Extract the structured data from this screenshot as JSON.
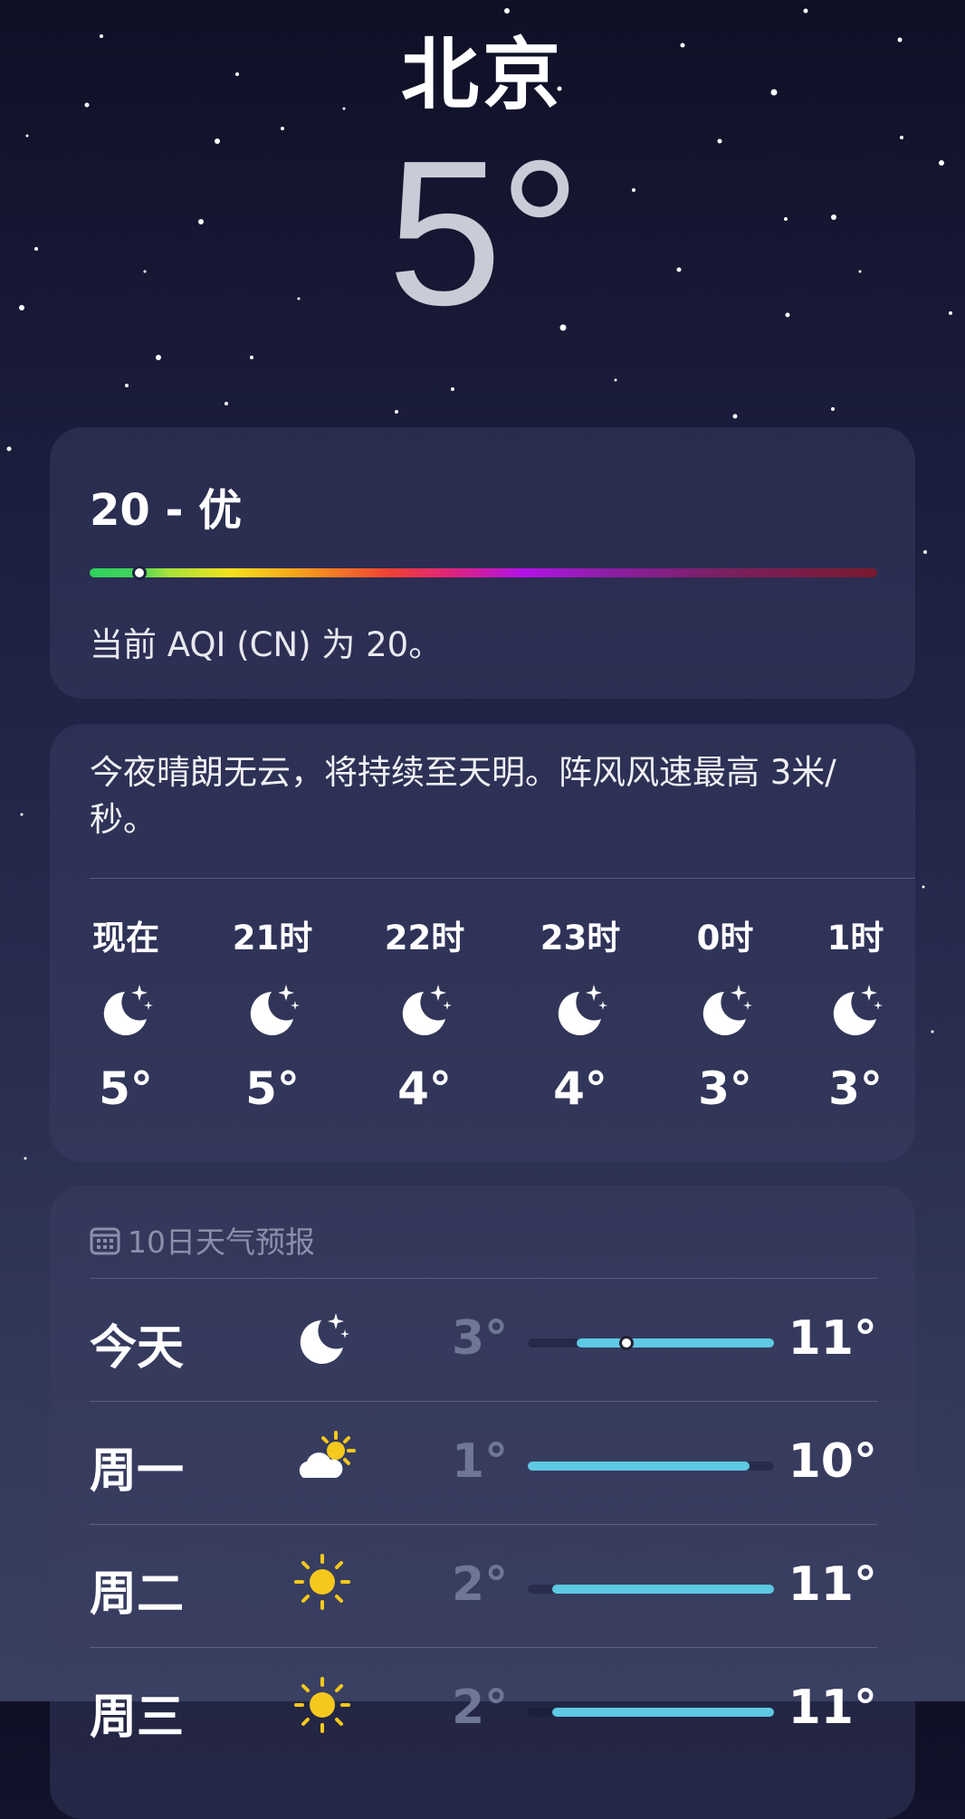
{
  "location": {
    "city": "北京",
    "temperature": "5°"
  },
  "aqi": {
    "title": "20 - 优",
    "value": 20,
    "scale_max": 500,
    "description": "当前 AQI (CN) 为 20。"
  },
  "hourly": {
    "summary": "今夜晴朗无云，将持续至天明。阵风风速最高 3米/秒。",
    "items": [
      {
        "time": "现在",
        "icon": "moon-stars-icon",
        "temp": "5°"
      },
      {
        "time": "21时",
        "icon": "moon-stars-icon",
        "temp": "5°"
      },
      {
        "time": "22时",
        "icon": "moon-stars-icon",
        "temp": "4°"
      },
      {
        "time": "23时",
        "icon": "moon-stars-icon",
        "temp": "4°"
      },
      {
        "time": "0时",
        "icon": "moon-stars-icon",
        "temp": "3°"
      },
      {
        "time": "1时",
        "icon": "moon-stars-icon",
        "temp": "3°"
      }
    ]
  },
  "forecast": {
    "title": "10日天气预报",
    "range_min": 1,
    "range_max": 11,
    "days": [
      {
        "day": "今天",
        "icon": "moon-stars-icon",
        "low": "3°",
        "high": "11°",
        "low_value": 3,
        "high_value": 11,
        "current_value": 5
      },
      {
        "day": "周一",
        "icon": "partly-cloudy-sun-icon",
        "low": "1°",
        "high": "10°",
        "low_value": 1,
        "high_value": 10
      },
      {
        "day": "周二",
        "icon": "sun-icon",
        "low": "2°",
        "high": "11°",
        "low_value": 2,
        "high_value": 11
      },
      {
        "day": "周三",
        "icon": "sun-icon",
        "low": "2°",
        "high": "11°",
        "low_value": 2,
        "high_value": 11
      }
    ]
  },
  "colors": {
    "bar_fill": "#5ec9e3",
    "card_bg": "#3a3e64",
    "sun": "#f7c81c"
  }
}
